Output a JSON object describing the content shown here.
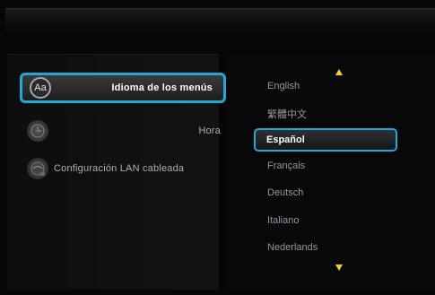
{
  "settings_menu": {
    "items": [
      {
        "icon": "language-icon",
        "icon_text": "Aa",
        "label": "Idioma de los menús",
        "selected": true
      },
      {
        "icon": "clock-icon",
        "label": "Hora",
        "selected": false
      },
      {
        "icon": "network-icon",
        "label": "Configuración LAN cableada",
        "selected": false
      }
    ]
  },
  "language_list": {
    "options": [
      "English",
      "繁體中文",
      "Español",
      "Français",
      "Deutsch",
      "Italiano",
      "Nederlands"
    ],
    "selected": "Español"
  },
  "colors": {
    "highlight_border": "#1fa9d6",
    "arrow": "#f2d51a",
    "selection_dot": "#f2b21a"
  }
}
